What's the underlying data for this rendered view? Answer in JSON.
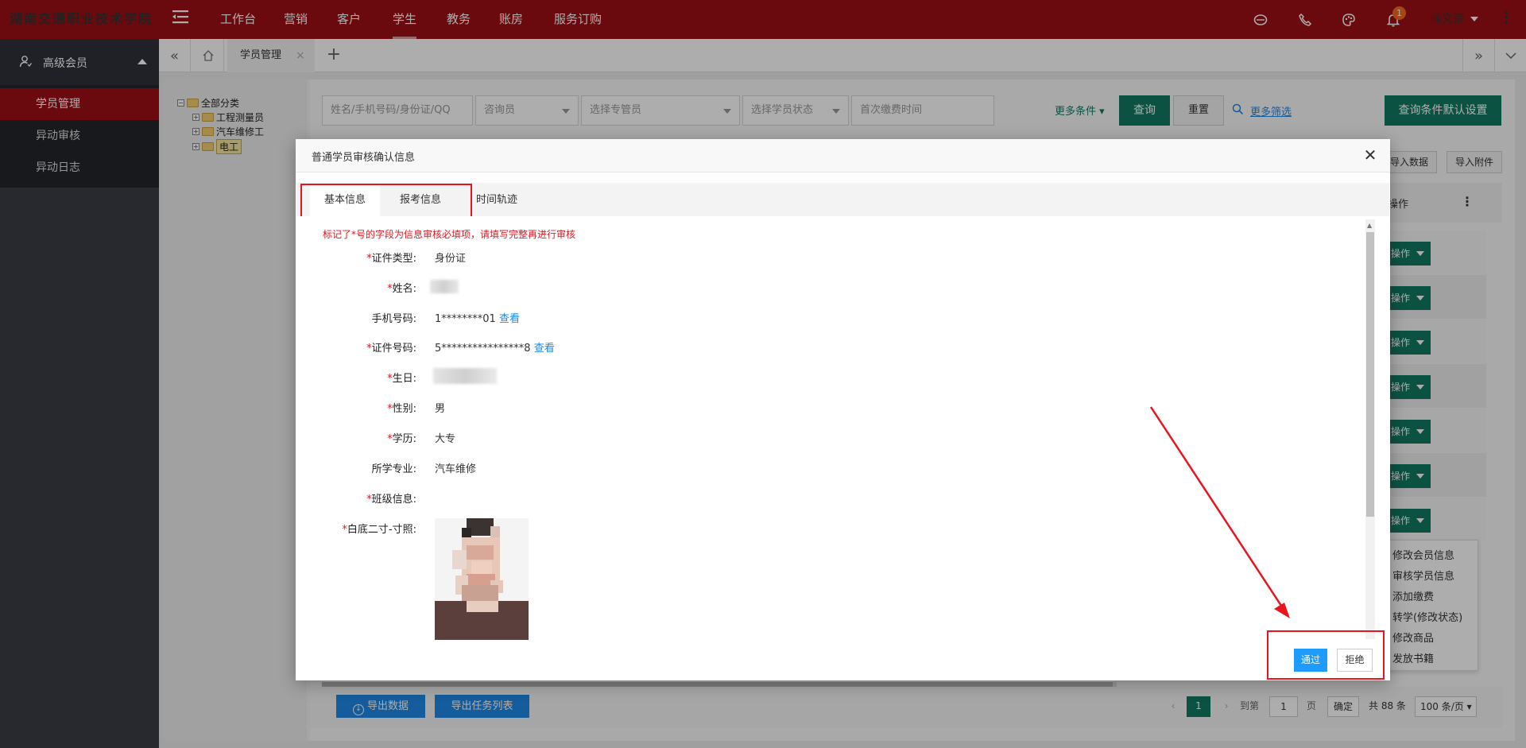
{
  "header": {
    "school_name": "湖南交通职业技术学院",
    "nav": [
      {
        "label": "工作台"
      },
      {
        "label": "营销"
      },
      {
        "label": "客户"
      },
      {
        "label": "学生"
      },
      {
        "label": "教务"
      },
      {
        "label": "账房"
      },
      {
        "label": "服务订购"
      }
    ],
    "notification_count": "1",
    "user_name": "喻文豪",
    "accent_color": "#9e0f15"
  },
  "sidebar": {
    "section_title": "高级会员",
    "items": [
      {
        "label": "学员管理"
      },
      {
        "label": "异动审核"
      },
      {
        "label": "异动日志"
      }
    ]
  },
  "tabs": {
    "open_tab": "学员管理"
  },
  "tree": {
    "root": "全部分类",
    "children": [
      {
        "label": "工程测量员"
      },
      {
        "label": "汽车维修工"
      },
      {
        "label": "电工"
      }
    ]
  },
  "filters": {
    "search_placeholder": "姓名/手机号码/身份证/QQ",
    "consultant": "咨询员",
    "advisor": "选择专管员",
    "status": "选择学员状态",
    "first_payment": "首次缴费时间",
    "more_conditions": "更多条件",
    "query": "查询",
    "reset": "重置",
    "more_filter": "更多筛选",
    "default_settings": "查询条件默认设置"
  },
  "toolbar": {
    "import_data": "导入数据",
    "import_attachment": "导入附件",
    "column_op": "操作"
  },
  "row_actions": {
    "op_label": "操作",
    "menu": [
      {
        "label": "修改会员信息"
      },
      {
        "label": "审核学员信息"
      },
      {
        "label": "添加缴费"
      },
      {
        "label": "转学(修改状态)"
      },
      {
        "label": "修改商品"
      },
      {
        "label": "发放书籍"
      }
    ]
  },
  "bottom": {
    "export_data": "导出数据",
    "export_tasks": "导出任务列表",
    "current_page": "1",
    "goto_label": "到第",
    "goto_value": "1",
    "page_unit": "页",
    "confirm": "确定",
    "total": "共 88 条",
    "page_size": "100 条/页"
  },
  "modal": {
    "title": "普通学员审核确认信息",
    "tabs": [
      {
        "label": "基本信息"
      },
      {
        "label": "报考信息"
      },
      {
        "label": "时间轨迹"
      }
    ],
    "warning": "标记了*号的字段为信息审核必填项，请填写完整再进行审核",
    "fields": {
      "id_type": {
        "label": "证件类型:",
        "value": "身份证"
      },
      "name": {
        "label": "姓名:"
      },
      "phone": {
        "label": "手机号码:",
        "value": "1********01",
        "link": "查看"
      },
      "id_number": {
        "label": "证件号码:",
        "value": "5****************8",
        "link": "查看"
      },
      "birthday": {
        "label": "生日:"
      },
      "gender": {
        "label": "性别:",
        "value": "男"
      },
      "education": {
        "label": "学历:",
        "value": "大专"
      },
      "major": {
        "label": "所学专业:",
        "value": "汽车维修"
      },
      "class_info": {
        "label": "班级信息:"
      },
      "photo": {
        "label": "白底二寸-寸照:"
      }
    },
    "req_mark": "*",
    "pass": "通过",
    "reject": "拒绝"
  }
}
